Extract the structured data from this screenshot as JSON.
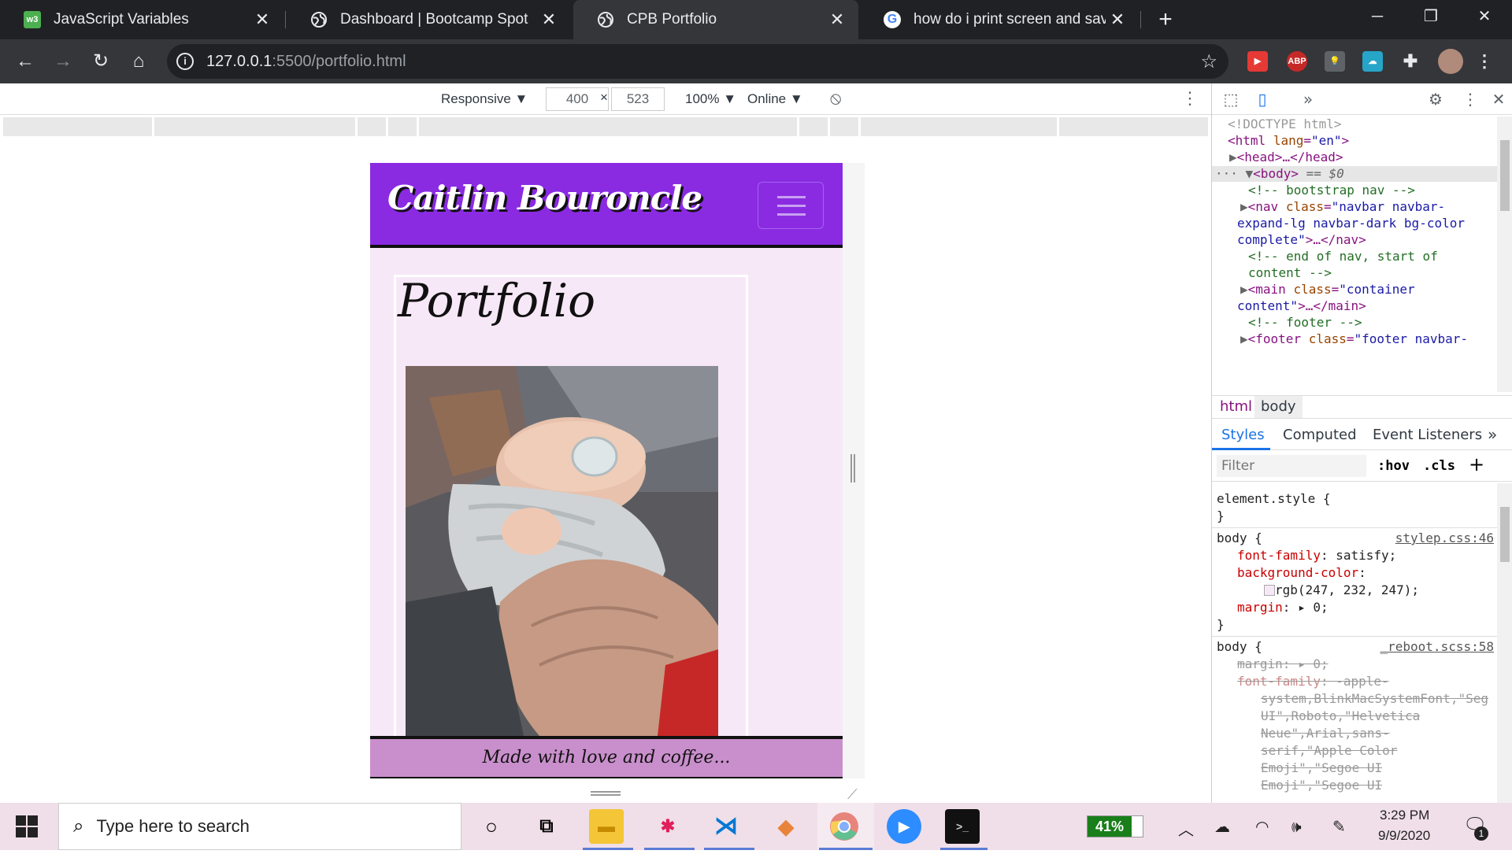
{
  "tabs": [
    {
      "title": "JavaScript Variables",
      "favicon": "w3schools-icon",
      "active": false
    },
    {
      "title": "Dashboard | Bootcamp Spot",
      "favicon": "globe-icon",
      "active": false
    },
    {
      "title": "CPB Portfolio",
      "favicon": "globe-icon",
      "active": true
    },
    {
      "title": "how do i print screen and save to",
      "favicon": "google-icon",
      "active": false
    }
  ],
  "omnibox": {
    "host": "127.0.0.1",
    "rest": ":5500/portfolio.html"
  },
  "extensions": {
    "abp": "ABP"
  },
  "device_toolbar": {
    "mode": "Responsive",
    "width": "400",
    "times": "×",
    "height": "523",
    "zoom": "100%",
    "network": "Online"
  },
  "page": {
    "brand": "Caitlin Bouroncle",
    "heading": "Portfolio",
    "footer": "Made with love and coffee...",
    "colors": {
      "navbar": "#8a2be2",
      "background": "#f7e8f7",
      "footer": "#c98fcc"
    }
  },
  "devtools": {
    "elements": {
      "doctype": "<!DOCTYPE html>",
      "html_open": "<html",
      "lang_attr": "lang",
      "lang_val": "\"en\"",
      "head": "<head>…</head>",
      "body": "<body>",
      "body_eq": "== $0",
      "cmt_nav": "<!-- bootstrap nav -->",
      "nav_open": "<nav",
      "nav_class_attr": "class",
      "nav_class_val1": "\"navbar navbar-",
      "nav_class_val2": "expand-lg navbar-dark bg-color",
      "nav_class_val3": "complete\"",
      "nav_close": ">…</nav>",
      "cmt_end_nav1": "<!-- end of nav, start of",
      "cmt_end_nav2": "content -->",
      "main_open": "<main",
      "main_class_val1": "\"container",
      "main_class_val2": "content\"",
      "main_close": ">…</main>",
      "cmt_footer": "<!-- footer -->",
      "footer_open": "<footer",
      "footer_class_val": "\"footer navbar-"
    },
    "crumbs": [
      "html",
      "body"
    ],
    "subtabs": [
      "Styles",
      "Computed",
      "Event Listeners"
    ],
    "filter_placeholder": "Filter",
    "hov": ":hov",
    "cls": ".cls",
    "styles": {
      "element_style": "element.style {",
      "close_brace": "}",
      "rule1_selector": "body {",
      "rule1_source": "stylep.css:46",
      "rule1_ff_prop": "font-family",
      "rule1_ff_val": ": satisfy;",
      "rule1_bg_prop": "background-color",
      "rule1_bg_colon": ":",
      "rule1_bg_val": "rgb(247, 232, 247);",
      "rule1_margin_prop": "margin",
      "rule1_margin_val": ": ▸ 0;",
      "rule2_selector": "body {",
      "rule2_source": "_reboot.scss:58",
      "rule2_margin": "margin: ▸ 0;",
      "rule2_ff_prop": "font-family",
      "rule2_ff_1": ": -apple-",
      "rule2_ff_2": "system,BlinkMacSystemFont,\"Seg",
      "rule2_ff_3": "UI\",Roboto,\"Helvetica",
      "rule2_ff_4": "Neue\",Arial,sans-",
      "rule2_ff_5": "serif,\"Apple Color",
      "rule2_ff_6": "Emoji\",\"Segoe UI",
      "rule2_ff_7": "Emoji\",\"Segoe UI"
    }
  },
  "taskbar": {
    "search_placeholder": "Type here to search",
    "battery": "41%",
    "time": "3:29 PM",
    "date": "9/9/2020",
    "notifications": "1"
  }
}
